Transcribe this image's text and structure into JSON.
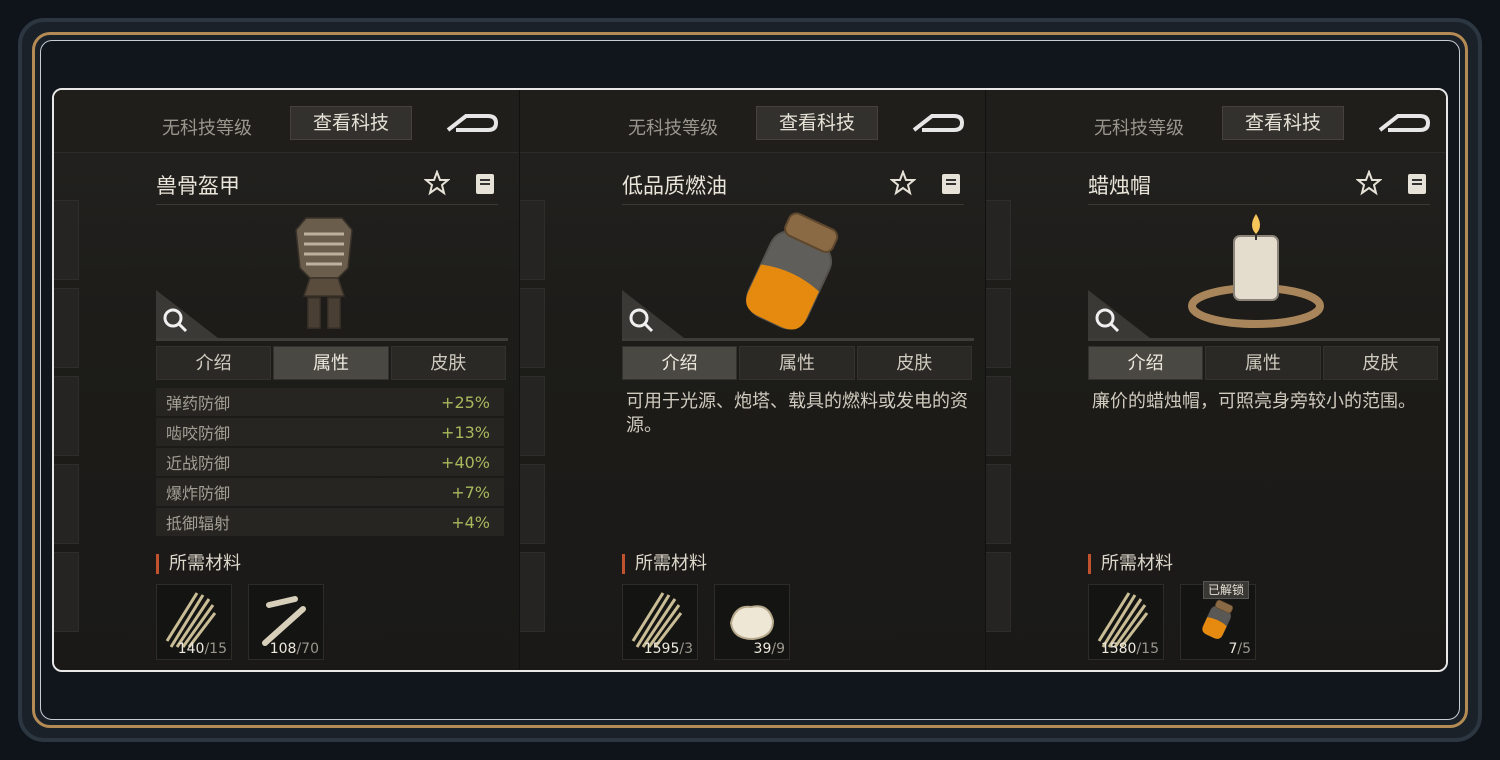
{
  "panels": [
    {
      "tech_level": "无科技等级",
      "view_tech_label": "查看科技",
      "item_name": "兽骨盔甲",
      "image_icon": "bone-armor-icon",
      "tabs": [
        "介绍",
        "属性",
        "皮肤"
      ],
      "active_tab": 1,
      "stats": [
        {
          "name": "弹药防御",
          "value": "+25%"
        },
        {
          "name": "啮咬防御",
          "value": "+13%"
        },
        {
          "name": "近战防御",
          "value": "+40%"
        },
        {
          "name": "爆炸防御",
          "value": "+7%"
        },
        {
          "name": "抵御辐射",
          "value": "+4%"
        }
      ],
      "description": "",
      "materials_title": "所需材料",
      "materials": [
        {
          "icon": "fiber-icon",
          "have": "140",
          "need": "/15"
        },
        {
          "icon": "bone-icon",
          "have": "108",
          "need": "/70"
        }
      ]
    },
    {
      "tech_level": "无科技等级",
      "view_tech_label": "查看科技",
      "item_name": "低品质燃油",
      "image_icon": "fuel-jar-icon",
      "tabs": [
        "介绍",
        "属性",
        "皮肤"
      ],
      "active_tab": 0,
      "stats": [],
      "description": "可用于光源、炮塔、载具的燃料或发电的资源。",
      "materials_title": "所需材料",
      "materials": [
        {
          "icon": "fiber-icon",
          "have": "1595",
          "need": "/3"
        },
        {
          "icon": "animal-fat-icon",
          "have": "39",
          "need": "/9"
        }
      ]
    },
    {
      "tech_level": "无科技等级",
      "view_tech_label": "查看科技",
      "item_name": "蜡烛帽",
      "image_icon": "candle-hat-icon",
      "tabs": [
        "介绍",
        "属性",
        "皮肤"
      ],
      "active_tab": 0,
      "stats": [],
      "description": "廉价的蜡烛帽，可照亮身旁较小的范围。",
      "materials_title": "所需材料",
      "materials": [
        {
          "icon": "fiber-icon",
          "have": "1580",
          "need": "/15"
        },
        {
          "icon": "fuel-jar-icon",
          "have": "7",
          "need": "/5",
          "badge": "已解锁"
        }
      ]
    }
  ],
  "colors": {
    "stat_value": "#a8b85c",
    "accent": "#c0532e",
    "frame_gold": "#b48a55"
  }
}
